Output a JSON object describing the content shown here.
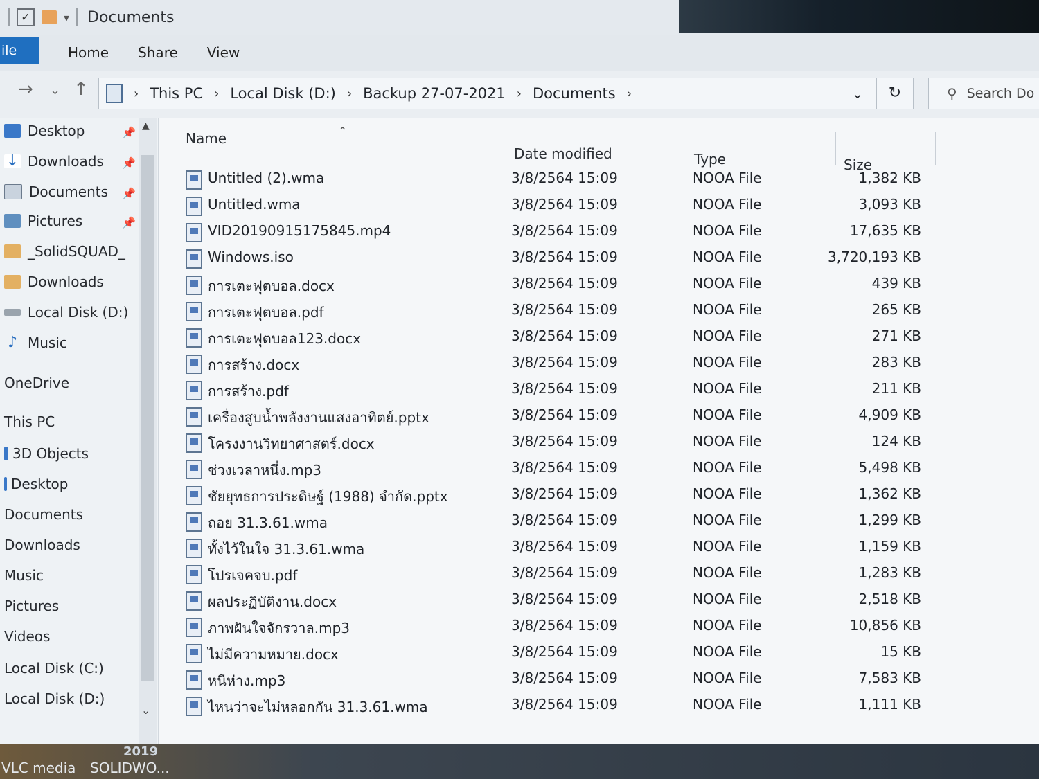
{
  "window": {
    "title": "Documents"
  },
  "ribbon": {
    "file_tab": "ile",
    "tabs": [
      "Home",
      "Share",
      "View"
    ]
  },
  "address": {
    "crumbs": [
      "This PC",
      "Local Disk (D:)",
      "Backup 27-07-2021",
      "Documents"
    ],
    "search_placeholder": "Search Do"
  },
  "sidebar": {
    "items": [
      {
        "label": "Desktop",
        "pinned": true
      },
      {
        "label": "Downloads",
        "pinned": true
      },
      {
        "label": "Documents",
        "pinned": true
      },
      {
        "label": "Pictures",
        "pinned": true
      },
      {
        "label": "_SolidSQUAD_",
        "pinned": false
      },
      {
        "label": "Downloads",
        "pinned": false
      },
      {
        "label": "Local Disk (D:)",
        "pinned": false
      },
      {
        "label": "Music",
        "pinned": false
      },
      {
        "label": "OneDrive",
        "pinned": false
      },
      {
        "label": "This PC",
        "pinned": false
      },
      {
        "label": "3D Objects",
        "pinned": false
      },
      {
        "label": "Desktop",
        "pinned": false
      },
      {
        "label": "Documents",
        "pinned": false
      },
      {
        "label": "Downloads",
        "pinned": false
      },
      {
        "label": "Music",
        "pinned": false
      },
      {
        "label": "Pictures",
        "pinned": false
      },
      {
        "label": "Videos",
        "pinned": false
      },
      {
        "label": "Local Disk (C:)",
        "pinned": false
      },
      {
        "label": "Local Disk (D:)",
        "pinned": false
      }
    ]
  },
  "columns": {
    "name": "Name",
    "date": "Date modified",
    "type": "Type",
    "size": "Size"
  },
  "files": [
    {
      "name": "Untitled (2).wma",
      "date": "3/8/2564 15:09",
      "type": "NOOA File",
      "size": "1,382 KB"
    },
    {
      "name": "Untitled.wma",
      "date": "3/8/2564 15:09",
      "type": "NOOA File",
      "size": "3,093 KB"
    },
    {
      "name": "VID20190915175845.mp4",
      "date": "3/8/2564 15:09",
      "type": "NOOA File",
      "size": "17,635 KB"
    },
    {
      "name": "Windows.iso",
      "date": "3/8/2564 15:09",
      "type": "NOOA File",
      "size": "3,720,193 KB"
    },
    {
      "name": "การเตะฟุตบอล.docx",
      "date": "3/8/2564 15:09",
      "type": "NOOA File",
      "size": "439 KB"
    },
    {
      "name": "การเตะฟุตบอล.pdf",
      "date": "3/8/2564 15:09",
      "type": "NOOA File",
      "size": "265 KB"
    },
    {
      "name": "การเตะฟุตบอล123.docx",
      "date": "3/8/2564 15:09",
      "type": "NOOA File",
      "size": "271 KB"
    },
    {
      "name": "การสร้าง.docx",
      "date": "3/8/2564 15:09",
      "type": "NOOA File",
      "size": "283 KB"
    },
    {
      "name": "การสร้าง.pdf",
      "date": "3/8/2564 15:09",
      "type": "NOOA File",
      "size": "211 KB"
    },
    {
      "name": "เครื่องสูบน้ำพลังงานแสงอาทิตย์.pptx",
      "date": "3/8/2564 15:09",
      "type": "NOOA File",
      "size": "4,909 KB"
    },
    {
      "name": "โครงงานวิทยาศาสตร์.docx",
      "date": "3/8/2564 15:09",
      "type": "NOOA File",
      "size": "124 KB"
    },
    {
      "name": "ช่วงเวลาหนึ่ง.mp3",
      "date": "3/8/2564 15:09",
      "type": "NOOA File",
      "size": "5,498 KB"
    },
    {
      "name": "ชัยยุทธการประดิษฐ์ (1988) จำกัด.pptx",
      "date": "3/8/2564 15:09",
      "type": "NOOA File",
      "size": "1,362 KB"
    },
    {
      "name": "ถอย 31.3.61.wma",
      "date": "3/8/2564 15:09",
      "type": "NOOA File",
      "size": "1,299 KB"
    },
    {
      "name": "ทั้งไว้ในใจ 31.3.61.wma",
      "date": "3/8/2564 15:09",
      "type": "NOOA File",
      "size": "1,159 KB"
    },
    {
      "name": "โปรเจคจบ.pdf",
      "date": "3/8/2564 15:09",
      "type": "NOOA File",
      "size": "1,283 KB"
    },
    {
      "name": "ผลประฏิบัติงาน.docx",
      "date": "3/8/2564 15:09",
      "type": "NOOA File",
      "size": "2,518 KB"
    },
    {
      "name": "ภาพฝันใจจักรวาล.mp3",
      "date": "3/8/2564 15:09",
      "type": "NOOA File",
      "size": "10,856 KB"
    },
    {
      "name": "ไม่มีความหมาย.docx",
      "date": "3/8/2564 15:09",
      "type": "NOOA File",
      "size": "15 KB"
    },
    {
      "name": "หนีห่าง.mp3",
      "date": "3/8/2564 15:09",
      "type": "NOOA File",
      "size": "7,583 KB"
    },
    {
      "name": "ไหนว่าจะไม่หลอกกัน 31.3.61.wma",
      "date": "3/8/2564 15:09",
      "type": "NOOA File",
      "size": "1,111 KB"
    }
  ],
  "taskbar": {
    "apps": [
      "VLC media",
      "SOLIDWO..."
    ],
    "badge": "2019"
  }
}
